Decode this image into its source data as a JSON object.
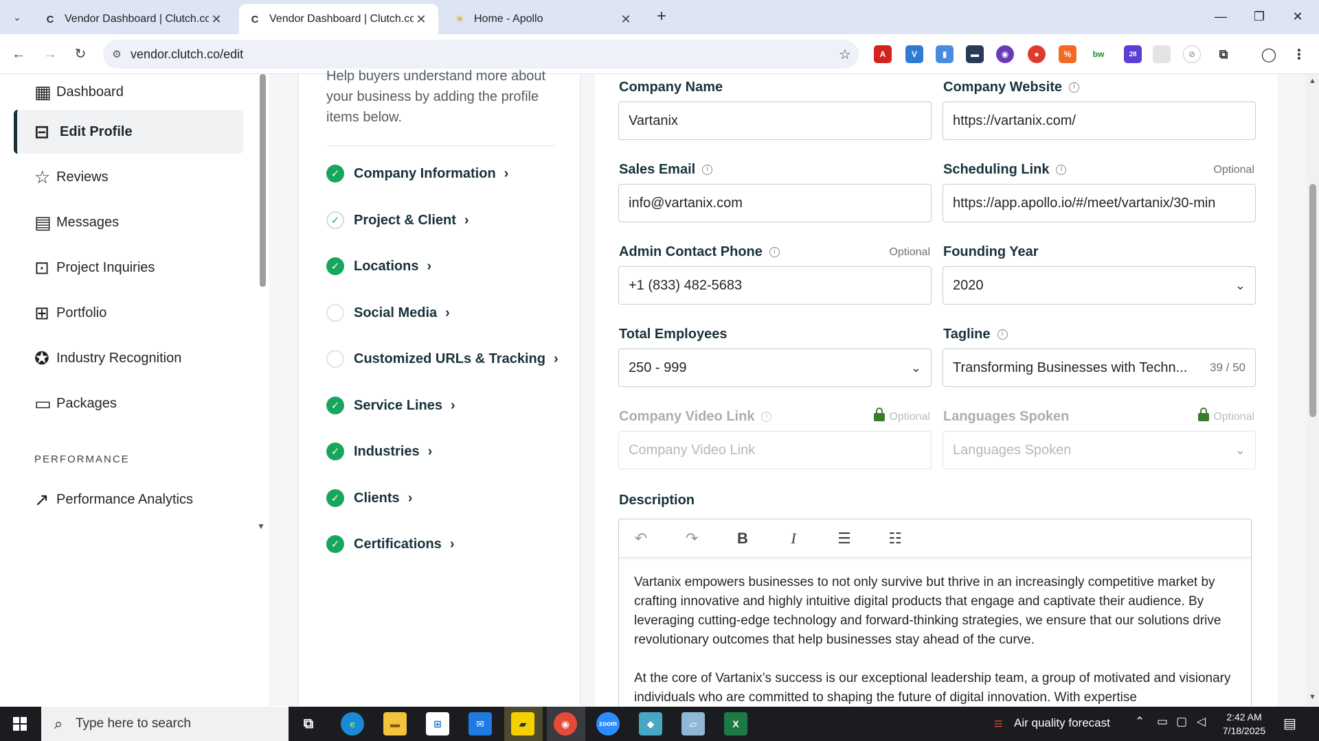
{
  "browser": {
    "tabs": [
      {
        "title": "Vendor Dashboard | Clutch.co",
        "active": false
      },
      {
        "title": "Vendor Dashboard | Clutch.co",
        "active": true
      },
      {
        "title": "Home - Apollo",
        "active": false
      }
    ],
    "url": "vendor.clutch.co/edit",
    "extension_badge": "28"
  },
  "sidebar": {
    "items": [
      {
        "label": "Dashboard",
        "icon": "grid-icon"
      },
      {
        "label": "Edit Profile",
        "icon": "storefront-icon",
        "active": true
      },
      {
        "label": "Reviews",
        "icon": "star-icon"
      },
      {
        "label": "Messages",
        "icon": "message-icon"
      },
      {
        "label": "Project Inquiries",
        "icon": "star-box-icon"
      },
      {
        "label": "Portfolio",
        "icon": "briefcase-icon"
      },
      {
        "label": "Industry Recognition",
        "icon": "badge-icon"
      },
      {
        "label": "Packages",
        "icon": "package-icon"
      }
    ],
    "section_performance": "PERFORMANCE",
    "performance_items": [
      {
        "label": "Performance Analytics",
        "icon": "analytics-icon"
      }
    ]
  },
  "checklist": {
    "intro": "Help buyers understand more about your business by adding the profile items below.",
    "items": [
      {
        "label": "Company Information",
        "status": "done"
      },
      {
        "label": "Project & Client",
        "status": "partial"
      },
      {
        "label": "Locations",
        "status": "done"
      },
      {
        "label": "Social Media",
        "status": "empty"
      },
      {
        "label": "Customized URLs & Tracking",
        "status": "empty"
      },
      {
        "label": "Service Lines",
        "status": "done"
      },
      {
        "label": "Industries",
        "status": "done"
      },
      {
        "label": "Clients",
        "status": "done"
      },
      {
        "label": "Certifications",
        "status": "done"
      }
    ]
  },
  "form": {
    "company_name": {
      "label": "Company Name",
      "value": "Vartanix"
    },
    "company_website": {
      "label": "Company Website",
      "value": "https://vartanix.com/"
    },
    "sales_email": {
      "label": "Sales Email",
      "value": "info@vartanix.com"
    },
    "scheduling_link": {
      "label": "Scheduling Link",
      "optional": "Optional",
      "value": "https://app.apollo.io/#/meet/vartanix/30-min"
    },
    "admin_phone": {
      "label": "Admin Contact Phone",
      "optional": "Optional",
      "value": "+1 (833) 482-5683"
    },
    "founding_year": {
      "label": "Founding Year",
      "value": "2020"
    },
    "total_employees": {
      "label": "Total Employees",
      "value": "250 - 999"
    },
    "tagline": {
      "label": "Tagline",
      "value": "Transforming Businesses with Techn...",
      "count": "39 / 50"
    },
    "video_link": {
      "label": "Company Video Link",
      "optional": "Optional",
      "placeholder": "Company Video Link"
    },
    "languages": {
      "label": "Languages Spoken",
      "optional": "Optional",
      "placeholder": "Languages Spoken"
    },
    "description": {
      "label": "Description",
      "paragraphs": [
        "Vartanix empowers businesses to not only survive but thrive in an increasingly competitive market by crafting innovative and highly intuitive digital products that engage and captivate their audience. By leveraging cutting-edge technology and forward-thinking strategies, we ensure that our solutions drive revolutionary outcomes that help businesses stay ahead of the curve.",
        "At the core of Vartanix’s success is our exceptional leadership team, a group of motivated and visionary individuals who are committed to shaping the future of digital innovation. With expertise"
      ]
    }
  },
  "taskbar": {
    "search_placeholder": "Type here to search",
    "weather": "Air quality forecast",
    "time": "2:42 AM",
    "date": "7/18/2025"
  },
  "colors": {
    "accent_dark": "#17313b",
    "check_green": "#17a65c",
    "tabbar_bg": "#dde5f4"
  }
}
